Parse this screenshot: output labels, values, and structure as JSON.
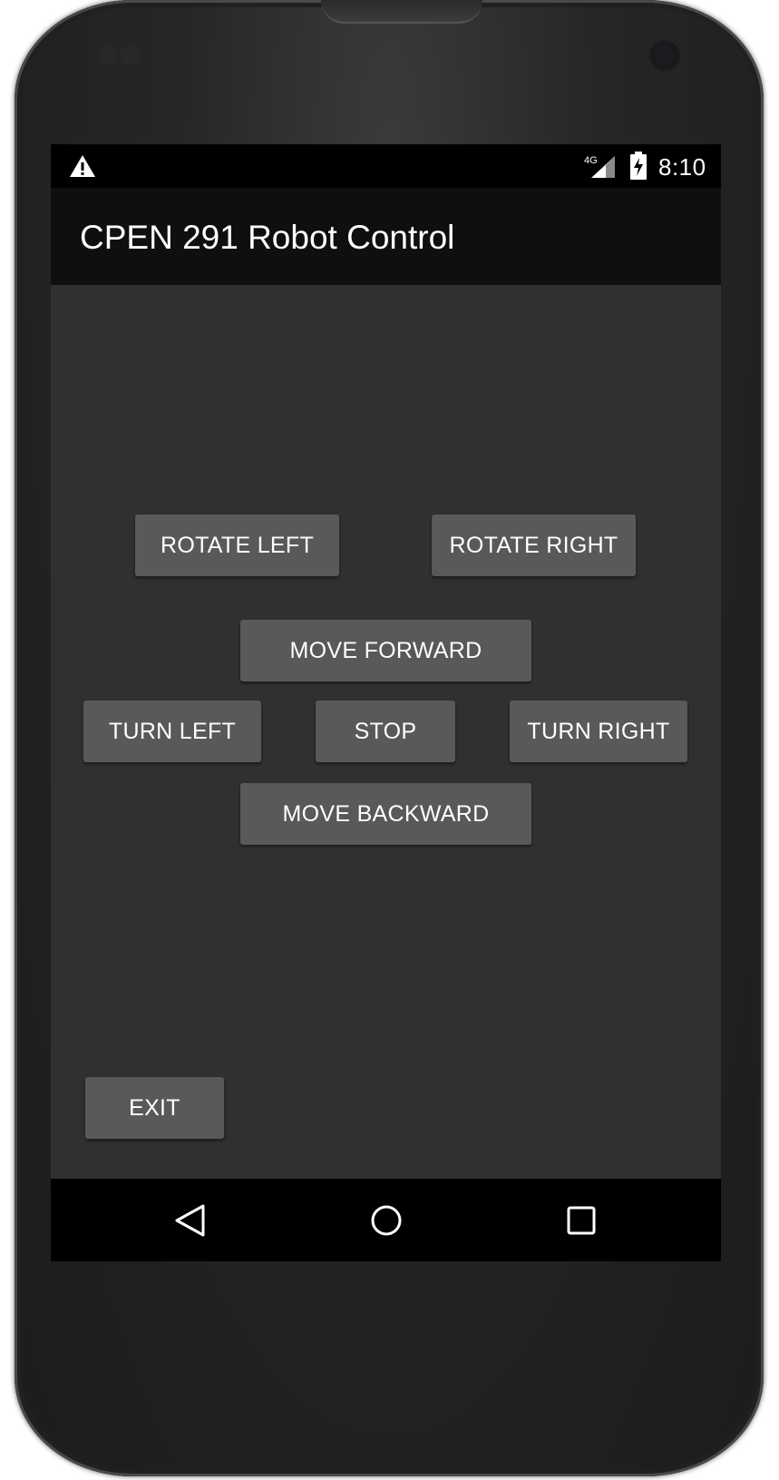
{
  "status_bar": {
    "icons": [
      "warning-icon",
      "signal-4g-icon",
      "battery-charging-icon"
    ],
    "network_label": "4G",
    "time": "8:10"
  },
  "action_bar": {
    "title": "CPEN 291 Robot Control"
  },
  "controls": {
    "rotate_left": "ROTATE LEFT",
    "rotate_right": "ROTATE RIGHT",
    "move_forward": "MOVE FORWARD",
    "turn_left": "TURN LEFT",
    "stop": "STOP",
    "turn_right": "TURN RIGHT",
    "move_backward": "MOVE BACKWARD",
    "exit": "EXIT"
  },
  "nav_bar": {
    "icons": [
      "back-icon",
      "home-icon",
      "recents-icon"
    ]
  },
  "colors": {
    "screen_background": "#303030",
    "action_bar": "#0f0f0f",
    "button": "#595959",
    "status_bar": "#000000",
    "text": "#ffffff"
  }
}
